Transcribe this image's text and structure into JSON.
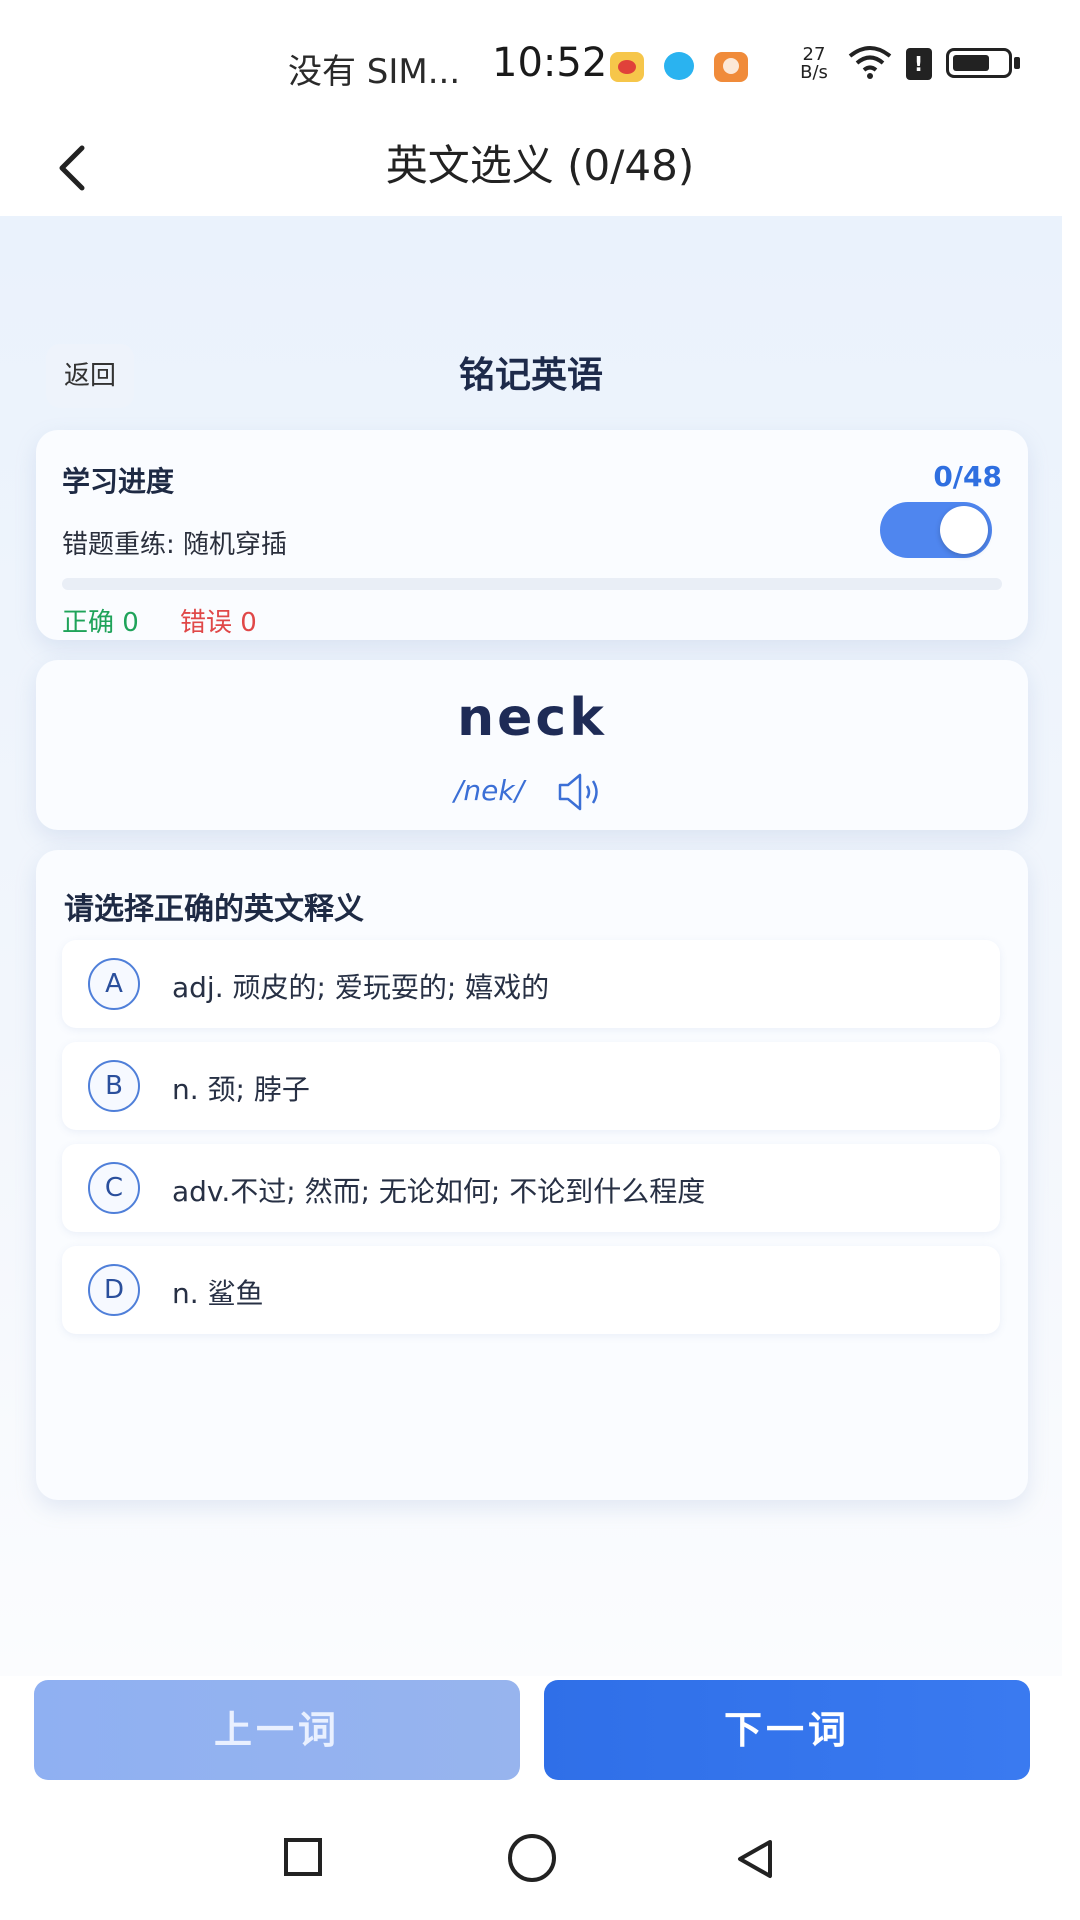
{
  "status_bar": {
    "carrier": "没有 SIM...",
    "time": "10:52",
    "speed_value": "27",
    "speed_unit": "B/s",
    "icons": [
      "weibo-icon",
      "bird-app-icon",
      "heart-app-icon",
      "wifi-icon",
      "sim-icon",
      "battery-icon"
    ]
  },
  "header": {
    "title": "英文选义 (0/48)",
    "back_icon": "chevron-left-icon"
  },
  "subheader": {
    "back_label": "返回",
    "title": "铭记英语"
  },
  "progress": {
    "label": "学习进度",
    "count": "0/48",
    "retry_label": "错题重练: 随机穿插",
    "retry_enabled": true,
    "completed_fraction": 0,
    "correct_text": "正确 0",
    "wrong_text": "错误 0",
    "colors": {
      "accent": "#4f86ef",
      "correct": "#1fa35a",
      "wrong": "#e04848"
    }
  },
  "word": {
    "text": "neck",
    "phonetic": "/nek/",
    "audio_icon": "speaker-icon"
  },
  "quiz": {
    "prompt": "请选择正确的英文释义",
    "options": [
      {
        "letter": "A",
        "text": "adj. 顽皮的; 爱玩耍的; 嬉戏的"
      },
      {
        "letter": "B",
        "text": "n. 颈; 脖子"
      },
      {
        "letter": "C",
        "text": "adv.不过; 然而; 无论如何; 不论到什么程度"
      },
      {
        "letter": "D",
        "text": "n. 鲨鱼"
      }
    ]
  },
  "buttons": {
    "prev_label": "上一词",
    "next_label": "下一词",
    "prev_enabled": false
  },
  "system_nav": {
    "icons": [
      "recent-apps-icon",
      "home-icon",
      "back-triangle-icon"
    ]
  }
}
